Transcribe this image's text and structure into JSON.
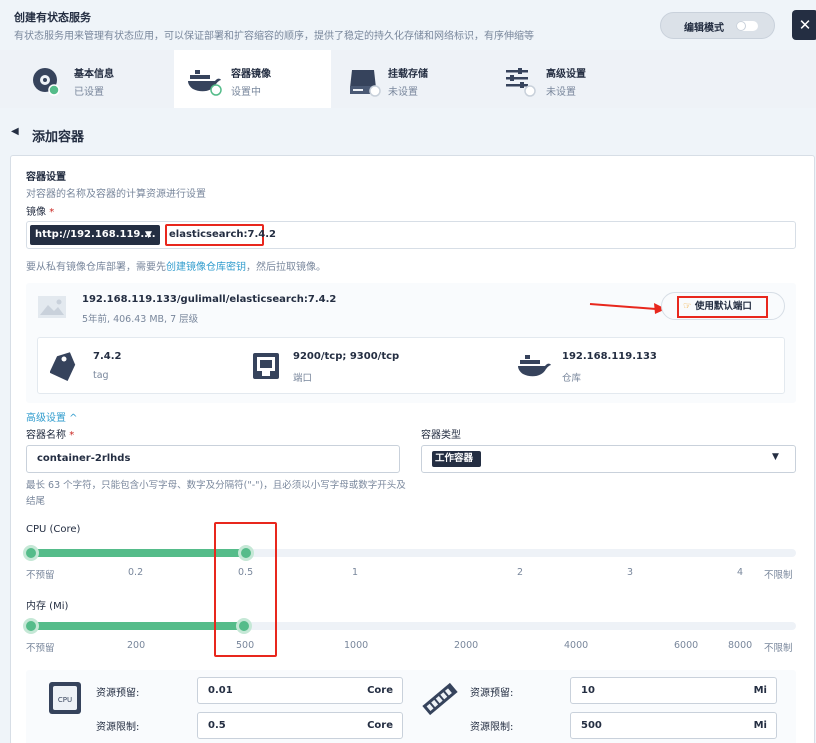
{
  "header": {
    "title": "创建有状态服务",
    "description": "有状态服务用来管理有状态应用，可以保证部署和扩容缩容的顺序，提供了稳定的持久化存储和网络标识，有序伸缩等",
    "edit_mode_label": "编辑模式",
    "close_symbol": "✕"
  },
  "steps": [
    {
      "label": "基本信息",
      "status": "已设置",
      "icon": "settings-disc-icon"
    },
    {
      "label": "容器镜像",
      "status": "设置中",
      "icon": "docker-whale-icon"
    },
    {
      "label": "挂载存储",
      "status": "未设置",
      "icon": "storage-drive-icon"
    },
    {
      "label": "高级设置",
      "status": "未设置",
      "icon": "sliders-icon"
    }
  ],
  "page": {
    "title": "添加容器"
  },
  "container_settings": {
    "section_title": "容器设置",
    "section_desc": "对容器的名称及容器的计算资源进行设置",
    "image_label": "镜像",
    "required_mark": "*",
    "registry_value": "http://192.168.119....",
    "image_value": "elasticsearch:7.4.2",
    "hint_prefix": "要从私有镜像仓库部署，需要先",
    "hint_link": "创建镜像仓库密钥",
    "hint_suffix": "，然后拉取镜像。"
  },
  "image_card": {
    "name": "192.168.119.133/gulimall/elasticsearch:7.4.2",
    "meta": "5年前, 406.43 MB, 7 层级",
    "default_port_label": "使用默认端口",
    "info": [
      {
        "value": "7.4.2",
        "key": "tag",
        "icon": "tag-icon"
      },
      {
        "value": "9200/tcp; 9300/tcp",
        "key": "端口",
        "icon": "port-icon"
      },
      {
        "value": "192.168.119.133",
        "key": "仓库",
        "icon": "docker-whale-icon"
      }
    ]
  },
  "advanced": {
    "toggle_label": "高级设置 ^",
    "name_label": "容器名称",
    "name_value": "container-2rlhds",
    "type_label": "容器类型",
    "type_value": "工作容器",
    "help_text": "最长 63 个字符，只能包含小写字母、数字及分隔符(\"-\")，且必须以小写字母或数字开头及结尾"
  },
  "cpu": {
    "label": "CPU (Core)",
    "value": 0.5,
    "ticks": [
      "不预留",
      "0.2",
      "0.5",
      "1",
      "2",
      "3",
      "4",
      "不限制"
    ]
  },
  "memory": {
    "label": "内存 (Mi)",
    "value": 500,
    "ticks": [
      "不预留",
      "200",
      "500",
      "1000",
      "2000",
      "4000",
      "6000",
      "8000",
      "不限制"
    ]
  },
  "resources": {
    "cpu_reserve_label": "资源预留:",
    "cpu_reserve_value": "0.01",
    "cpu_limit_label": "资源限制:",
    "cpu_limit_value": "0.5",
    "cpu_unit": "Core",
    "cpu_chip_text": "CPU",
    "mem_reserve_label": "资源预留:",
    "mem_reserve_value": "10",
    "mem_limit_label": "资源限制:",
    "mem_limit_value": "500",
    "mem_unit": "Mi"
  },
  "colors": {
    "accent_green": "#55bc8a",
    "dark": "#242e42",
    "link_blue": "#329dce",
    "annotation_red": "#e8271d"
  }
}
